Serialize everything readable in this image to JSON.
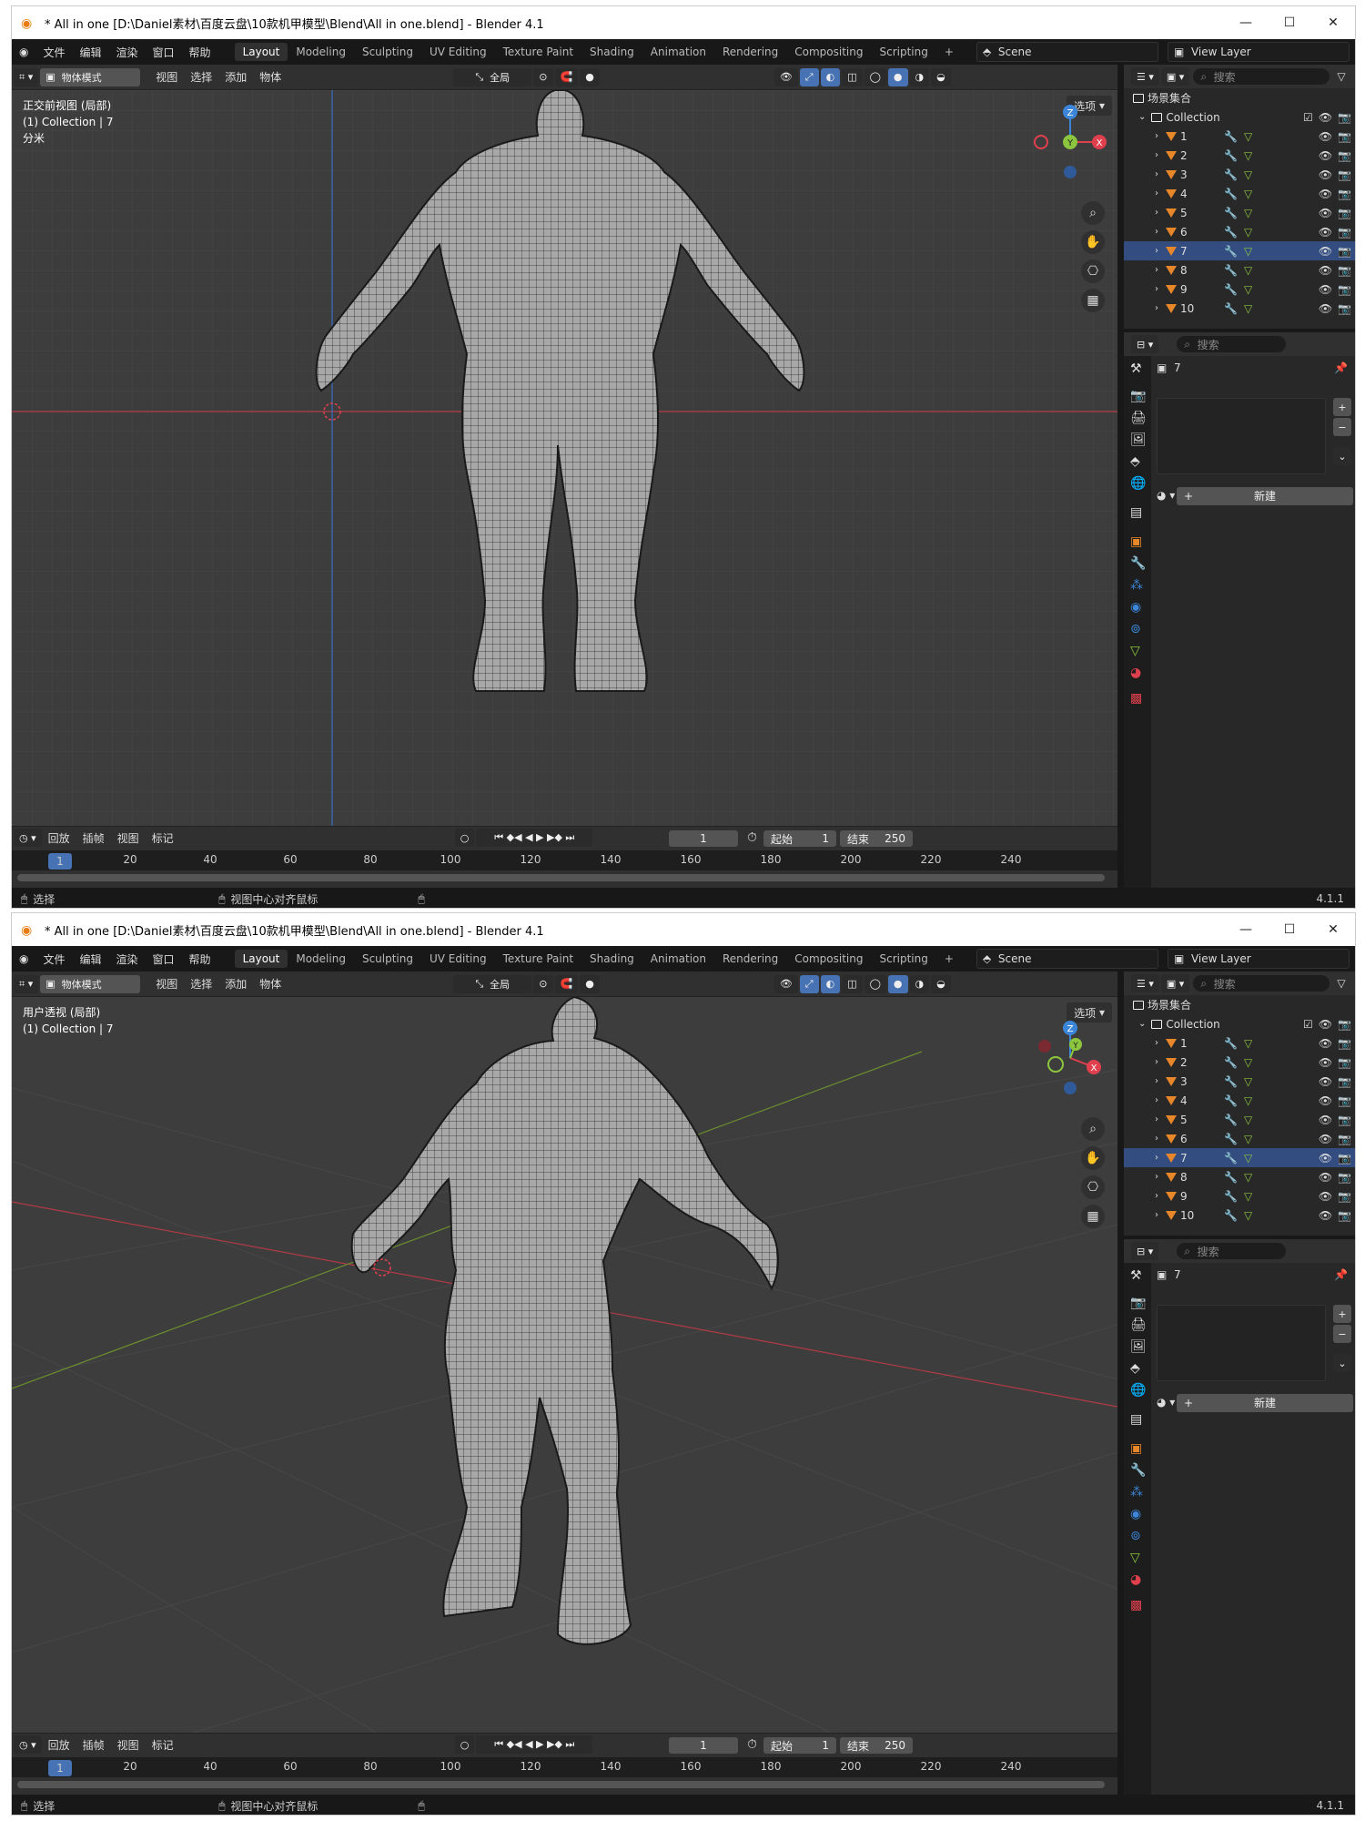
{
  "window": {
    "title": "* All in one [D:\\Daniel素材\\百度云盘\\10款机甲模型\\Blend\\All in one.blend] - Blender 4.1",
    "min": "—",
    "max": "☐",
    "close": "✕"
  },
  "menu": [
    "文件",
    "编辑",
    "渲染",
    "窗口",
    "帮助"
  ],
  "workspaces": [
    "Layout",
    "Modeling",
    "Sculpting",
    "UV Editing",
    "Texture Paint",
    "Shading",
    "Animation",
    "Rendering",
    "Compositing",
    "Scripting"
  ],
  "add_workspace": "+",
  "scene": "Scene",
  "view_layer": "View Layer",
  "viewport_header": {
    "mode": "物体模式",
    "items": [
      "视图",
      "选择",
      "添加",
      "物体"
    ],
    "transform": "全局",
    "options": "选项"
  },
  "view1": {
    "lines": [
      "正交前视图 (局部)",
      "(1) Collection | 7",
      "分米"
    ]
  },
  "view2": {
    "lines": [
      "用户透视 (局部)",
      "(1) Collection | 7"
    ]
  },
  "gizmo": {
    "z": "Z",
    "y": "Y",
    "x": "X"
  },
  "timeline": {
    "items": [
      "回放",
      "插帧",
      "视图",
      "标记"
    ],
    "current_frame": "1",
    "start_label": "起始",
    "start": "1",
    "end_label": "结束",
    "end": "250",
    "ticks": [
      "20",
      "40",
      "60",
      "80",
      "100",
      "120",
      "140",
      "160",
      "180",
      "200",
      "220",
      "240"
    ]
  },
  "status": {
    "select": "选择",
    "center": "视图中心对齐鼠标",
    "version": "4.1.1"
  },
  "outliner": {
    "search_placeholder": "搜索",
    "scene_collection": "场景集合",
    "collection": "Collection",
    "objects": [
      "1",
      "2",
      "3",
      "4",
      "5",
      "6",
      "7",
      "8",
      "9",
      "10"
    ],
    "selected": "7"
  },
  "properties": {
    "search_placeholder": "搜索",
    "object_name": "7",
    "new_button": "新建",
    "plus": "+",
    "minus": "−"
  },
  "colors": {
    "accent_blue": "#4772b3",
    "object_orange": "#e8862a",
    "axis_x": "#e0404e",
    "axis_y": "#8cc63f",
    "axis_z": "#3b86d8"
  }
}
